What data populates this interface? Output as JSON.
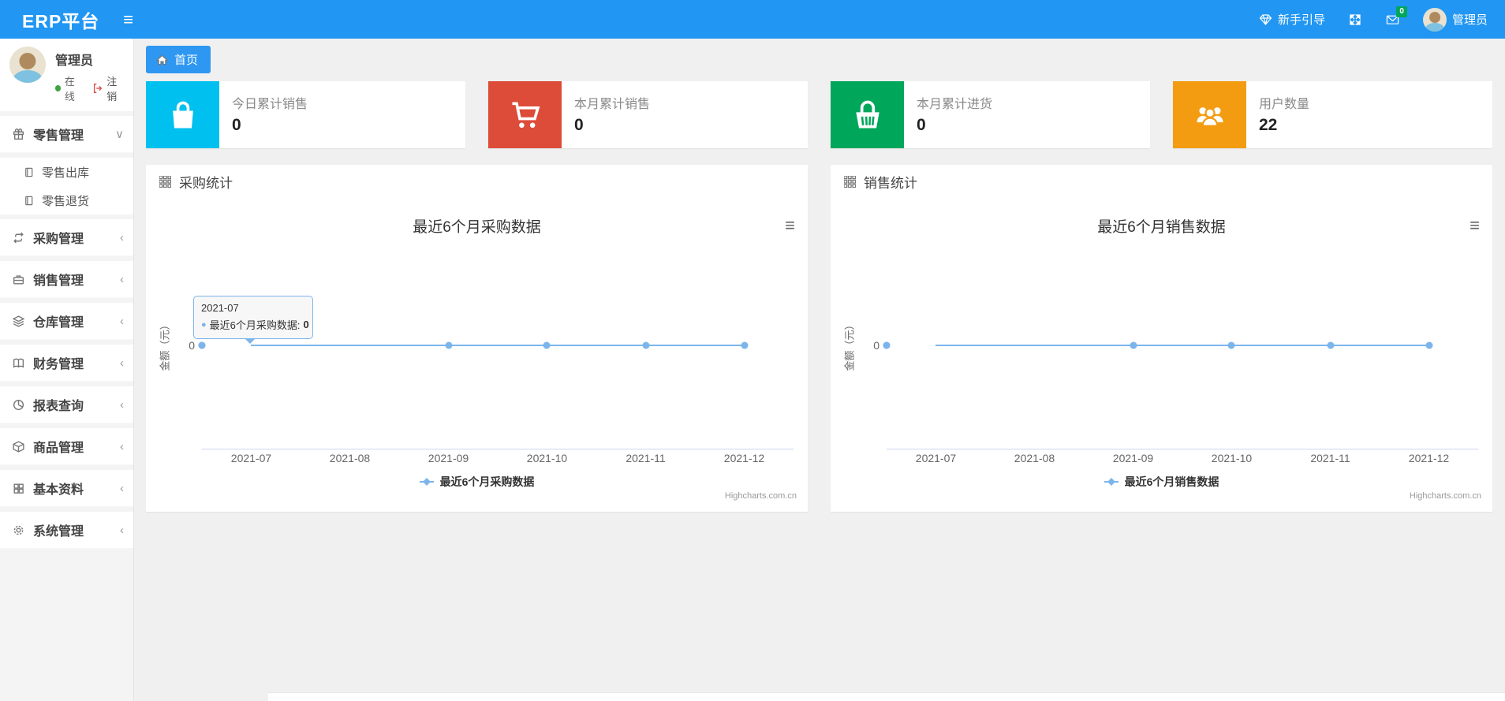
{
  "icons": {
    "hamburger": "≡",
    "chart_menu": "≡",
    "chevron_down": "∨",
    "chevron_left": "‹",
    "legend_bullet": "●",
    "tooltip_bullet": "●",
    "named": [
      "hamburger-icon",
      "gem-icon",
      "expand-icon",
      "envelope-icon",
      "avatar",
      "home-icon",
      "gift-icon",
      "journal-icon",
      "repeat-icon",
      "briefcase-icon",
      "layers-icon",
      "book-icon",
      "pie-chart-icon",
      "package-icon",
      "grid-icon",
      "gear-icon",
      "bag-icon",
      "cart-icon",
      "basket-icon",
      "users-icon",
      "grid-9-icon"
    ]
  },
  "colors": {
    "navbar": "#2196f3",
    "tab": "#2e97f2",
    "card_info": "#00c0ef",
    "card_danger": "#dd4b39",
    "card_success": "#00a65a",
    "card_warning": "#f39c12",
    "series": "#7cb5ec",
    "badge": "#00a65a"
  },
  "navbar": {
    "brand": "ERP平台",
    "guide": "新手引导",
    "mail_badge": "0",
    "username": "管理员"
  },
  "sidebar": {
    "user": {
      "name": "管理员",
      "status": "在线",
      "logout": "注销"
    },
    "items": [
      {
        "label": "零售管理",
        "icon": "gift-icon",
        "expanded": true,
        "children": [
          {
            "label": "零售出库",
            "icon": "journal-icon"
          },
          {
            "label": "零售退货",
            "icon": "journal-icon"
          }
        ]
      },
      {
        "label": "采购管理",
        "icon": "repeat-icon"
      },
      {
        "label": "销售管理",
        "icon": "briefcase-icon"
      },
      {
        "label": "仓库管理",
        "icon": "layers-icon"
      },
      {
        "label": "财务管理",
        "icon": "book-icon"
      },
      {
        "label": "报表查询",
        "icon": "pie-chart-icon"
      },
      {
        "label": "商品管理",
        "icon": "package-icon"
      },
      {
        "label": "基本资料",
        "icon": "grid-icon"
      },
      {
        "label": "系统管理",
        "icon": "gear-icon"
      }
    ]
  },
  "breadcrumb": {
    "home_label": "首页"
  },
  "stat_cards": [
    {
      "title": "今日累计销售",
      "value": "0",
      "icon": "bag-icon",
      "color": "#00c0ef"
    },
    {
      "title": "本月累计销售",
      "value": "0",
      "icon": "cart-icon",
      "color": "#dd4b39"
    },
    {
      "title": "本月累计进货",
      "value": "0",
      "icon": "basket-icon",
      "color": "#00a65a"
    },
    {
      "title": "用户数量",
      "value": "22",
      "icon": "users-icon",
      "color": "#f39c12"
    }
  ],
  "chart_data": [
    {
      "type": "line",
      "panel_title": "采购统计",
      "title": "最近6个月采购数据",
      "categories": [
        "2021-07",
        "2021-08",
        "2021-09",
        "2021-10",
        "2021-11",
        "2021-12"
      ],
      "series": [
        {
          "name": "最近6个月采购数据",
          "values": [
            0,
            0,
            0,
            0,
            0,
            0
          ],
          "color": "#7cb5ec"
        }
      ],
      "ylabel": "金额（元）",
      "ytick": "0",
      "ylim": [
        -1,
        1
      ],
      "grid": false,
      "legend_position": "bottom",
      "credit": "Highcharts.com.cn",
      "tooltip": {
        "visible": true,
        "category": "2021-07",
        "series_label": "最近6个月采购数据: ",
        "value": "0"
      }
    },
    {
      "type": "line",
      "panel_title": "销售统计",
      "title": "最近6个月销售数据",
      "categories": [
        "2021-07",
        "2021-08",
        "2021-09",
        "2021-10",
        "2021-11",
        "2021-12"
      ],
      "series": [
        {
          "name": "最近6个月销售数据",
          "values": [
            0,
            0,
            0,
            0,
            0,
            0
          ],
          "color": "#7cb5ec"
        }
      ],
      "ylabel": "金额（元）",
      "ytick": "0",
      "ylim": [
        -1,
        1
      ],
      "grid": false,
      "legend_position": "bottom",
      "credit": "Highcharts.com.cn",
      "tooltip": {
        "visible": false
      }
    }
  ]
}
